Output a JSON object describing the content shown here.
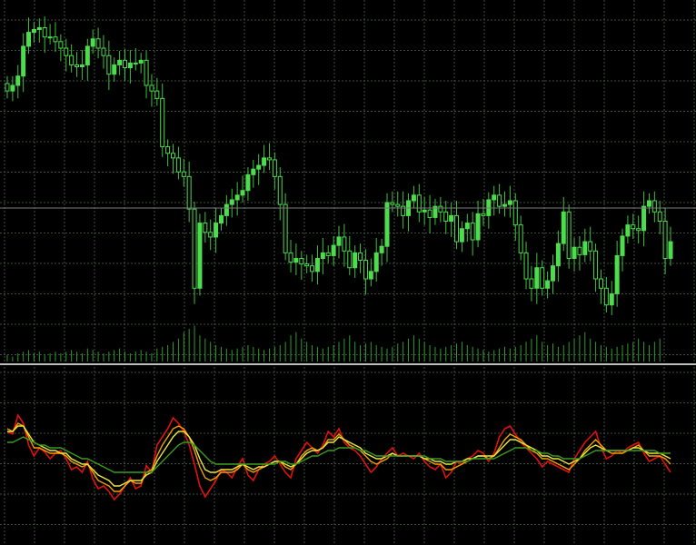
{
  "chart_data": [
    {
      "type": "candlestick",
      "panel": "price",
      "colors": {
        "candle": "#4ddc4d",
        "wick": "#3fbf3f",
        "grid": "#3d4f3d",
        "background": "#000000",
        "hline": "#7a7a7a"
      },
      "grid": true,
      "x": [
        0,
        1,
        2,
        3,
        4,
        5,
        6,
        7,
        8,
        9,
        10,
        11,
        12,
        13,
        14,
        15,
        16,
        17,
        18,
        19,
        20,
        21,
        22,
        23,
        24,
        25,
        26,
        27,
        28,
        29,
        30,
        31,
        32,
        33,
        34,
        35,
        36,
        37,
        38,
        39,
        40,
        41,
        42,
        43,
        44,
        45,
        46,
        47,
        48,
        49,
        50,
        51,
        52,
        53,
        54,
        55,
        56,
        57,
        58,
        59,
        60,
        61,
        62,
        63,
        64,
        65,
        66,
        67,
        68,
        69,
        70,
        71,
        72,
        73,
        74,
        75,
        76,
        77,
        78,
        79,
        80,
        81,
        82,
        83,
        84,
        85,
        86,
        87,
        88,
        89,
        90,
        91,
        92,
        93,
        94,
        95,
        96,
        97,
        98,
        99,
        100,
        101,
        102,
        103,
        104,
        105,
        106,
        107,
        108,
        109,
        110,
        111,
        112,
        113,
        114,
        115,
        116,
        117,
        118,
        119,
        120,
        121,
        122
      ],
      "close": [
        88,
        82,
        72,
        40,
        25,
        22,
        20,
        30,
        30,
        35,
        42,
        50,
        60,
        62,
        60,
        40,
        32,
        42,
        50,
        70,
        60,
        55,
        63,
        58,
        58,
        55,
        82,
        88,
        96,
        148,
        155,
        160,
        175,
        180,
        215,
        300,
        230,
        240,
        245,
        230,
        222,
        210,
        205,
        200,
        195,
        178,
        172,
        168,
        160,
        162,
        180,
        210,
        262,
        272,
        268,
        274,
        276,
        282,
        268,
        262,
        265,
        254,
        245,
        260,
        278,
        262,
        270,
        290,
        282,
        262,
        255,
        208,
        210,
        212,
        222,
        206,
        200,
        218,
        216,
        224,
        212,
        218,
        228,
        222,
        250,
        236,
        230,
        248,
        220,
        222,
        205,
        200,
        212,
        210,
        206,
        232,
        262,
        290,
        300,
        278,
        300,
        292,
        276,
        252,
        218,
        268,
        256,
        264,
        250,
        260,
        290,
        300,
        318,
        306,
        265,
        244,
        232,
        236,
        238,
        212,
        206,
        218,
        228,
        268,
        250
      ],
      "open": [
        80,
        88,
        82,
        72,
        40,
        25,
        22,
        20,
        30,
        30,
        35,
        42,
        50,
        60,
        62,
        60,
        40,
        32,
        42,
        50,
        70,
        60,
        55,
        63,
        58,
        58,
        55,
        82,
        88,
        96,
        148,
        155,
        160,
        175,
        180,
        215,
        300,
        230,
        240,
        245,
        230,
        222,
        210,
        205,
        200,
        195,
        178,
        172,
        168,
        160,
        162,
        180,
        210,
        262,
        272,
        268,
        274,
        276,
        282,
        268,
        262,
        265,
        254,
        245,
        260,
        278,
        262,
        270,
        290,
        282,
        262,
        255,
        208,
        210,
        212,
        222,
        206,
        200,
        218,
        216,
        224,
        212,
        218,
        228,
        222,
        250,
        236,
        230,
        248,
        220,
        222,
        205,
        200,
        212,
        210,
        206,
        232,
        262,
        290,
        300,
        278,
        300,
        292,
        276,
        252,
        218,
        268,
        256,
        264,
        250,
        260,
        290,
        300,
        318,
        306,
        265,
        244,
        232,
        236,
        238,
        212,
        206,
        218,
        228,
        268
      ],
      "volume": [
        4,
        3,
        5,
        6,
        7,
        5,
        6,
        4,
        5,
        6,
        5,
        6,
        7,
        6,
        5,
        8,
        7,
        6,
        5,
        6,
        7,
        8,
        6,
        5,
        6,
        7,
        6,
        5,
        8,
        9,
        10,
        12,
        14,
        18,
        20,
        22,
        16,
        14,
        12,
        10,
        9,
        8,
        7,
        8,
        9,
        10,
        9,
        8,
        7,
        8,
        9,
        10,
        12,
        16,
        18,
        14,
        12,
        10,
        9,
        8,
        9,
        10,
        12,
        14,
        16,
        12,
        10,
        11,
        12,
        10,
        9,
        8,
        9,
        11,
        12,
        14,
        16,
        14,
        12,
        10,
        9,
        8,
        9,
        10,
        11,
        12,
        10,
        9,
        8,
        7,
        6,
        7,
        8,
        9,
        8,
        9,
        10,
        12,
        14,
        16,
        12,
        10,
        11,
        9,
        10,
        12,
        14,
        16,
        18,
        14,
        12,
        10,
        9,
        8,
        9,
        10,
        11,
        12,
        14,
        12,
        10,
        12,
        14
      ]
    },
    {
      "type": "line",
      "panel": "oscillator",
      "grid": true,
      "series": [
        {
          "color": "#e01010",
          "values": [
            70,
            68,
            82,
            76,
            60,
            52,
            58,
            55,
            50,
            54,
            56,
            50,
            42,
            44,
            40,
            48,
            35,
            28,
            30,
            26,
            20,
            24,
            30,
            36,
            28,
            30,
            45,
            40,
            60,
            66,
            72,
            80,
            76,
            70,
            60,
            46,
            30,
            22,
            28,
            34,
            42,
            40,
            36,
            44,
            50,
            38,
            34,
            42,
            46,
            48,
            52,
            46,
            40,
            36,
            50,
            56,
            62,
            58,
            54,
            60,
            70,
            66,
            72,
            62,
            58,
            56,
            52,
            46,
            40,
            44,
            50,
            54,
            58,
            52,
            54,
            52,
            50,
            54,
            48,
            44,
            42,
            46,
            36,
            40,
            48,
            46,
            50,
            52,
            56,
            54,
            48,
            54,
            66,
            72,
            74,
            68,
            62,
            58,
            54,
            50,
            44,
            48,
            46,
            44,
            42,
            40,
            50,
            56,
            62,
            66,
            70,
            58,
            50,
            52,
            56,
            54,
            58,
            60,
            62,
            54,
            48,
            50,
            52,
            46,
            40
          ]
        },
        {
          "color": "#f0a000",
          "values": [
            72,
            70,
            76,
            74,
            66,
            58,
            58,
            56,
            54,
            54,
            54,
            52,
            48,
            46,
            44,
            46,
            40,
            34,
            32,
            30,
            26,
            26,
            30,
            34,
            32,
            32,
            40,
            42,
            52,
            60,
            66,
            72,
            74,
            72,
            66,
            56,
            44,
            36,
            34,
            36,
            40,
            40,
            40,
            42,
            46,
            42,
            40,
            42,
            44,
            46,
            48,
            48,
            44,
            42,
            46,
            52,
            56,
            58,
            56,
            58,
            64,
            64,
            68,
            64,
            60,
            58,
            56,
            52,
            48,
            46,
            48,
            50,
            54,
            52,
            52,
            52,
            52,
            52,
            50,
            48,
            46,
            46,
            42,
            42,
            44,
            46,
            48,
            50,
            52,
            52,
            50,
            52,
            58,
            64,
            68,
            66,
            64,
            60,
            56,
            54,
            50,
            50,
            48,
            46,
            44,
            42,
            46,
            50,
            56,
            60,
            64,
            60,
            56,
            54,
            54,
            54,
            56,
            58,
            60,
            56,
            52,
            52,
            52,
            50,
            46
          ]
        },
        {
          "color": "#e8e840",
          "values": [
            70,
            70,
            74,
            74,
            68,
            62,
            60,
            58,
            56,
            56,
            54,
            54,
            50,
            48,
            46,
            46,
            42,
            38,
            36,
            34,
            30,
            30,
            32,
            34,
            34,
            34,
            38,
            40,
            48,
            54,
            60,
            66,
            70,
            70,
            66,
            60,
            50,
            42,
            40,
            40,
            42,
            42,
            42,
            44,
            46,
            44,
            42,
            44,
            44,
            46,
            48,
            48,
            46,
            44,
            46,
            50,
            54,
            56,
            56,
            58,
            62,
            62,
            66,
            64,
            62,
            60,
            58,
            54,
            52,
            50,
            50,
            52,
            54,
            52,
            52,
            52,
            52,
            52,
            50,
            50,
            48,
            48,
            46,
            46,
            48,
            48,
            50,
            50,
            52,
            52,
            52,
            52,
            56,
            60,
            64,
            64,
            62,
            60,
            58,
            56,
            52,
            52,
            50,
            50,
            48,
            46,
            48,
            50,
            54,
            58,
            60,
            58,
            56,
            56,
            56,
            56,
            56,
            58,
            58,
            56,
            54,
            54,
            54,
            52,
            50
          ]
        },
        {
          "color": "#3a9a20",
          "values": [
            62,
            62,
            64,
            66,
            64,
            62,
            60,
            60,
            58,
            58,
            58,
            56,
            54,
            52,
            50,
            50,
            48,
            46,
            44,
            42,
            40,
            40,
            40,
            40,
            40,
            40,
            40,
            40,
            44,
            48,
            52,
            56,
            60,
            62,
            62,
            60,
            56,
            52,
            48,
            46,
            46,
            46,
            46,
            46,
            46,
            46,
            46,
            46,
            46,
            46,
            46,
            48,
            48,
            46,
            46,
            48,
            50,
            52,
            52,
            54,
            56,
            56,
            58,
            58,
            58,
            58,
            56,
            56,
            54,
            52,
            52,
            52,
            52,
            52,
            52,
            52,
            52,
            52,
            52,
            50,
            50,
            50,
            48,
            48,
            48,
            48,
            48,
            50,
            50,
            50,
            50,
            50,
            52,
            54,
            56,
            58,
            58,
            58,
            56,
            56,
            54,
            54,
            52,
            52,
            50,
            50,
            50,
            50,
            52,
            54,
            56,
            56,
            56,
            56,
            56,
            56,
            56,
            56,
            56,
            56,
            56,
            56,
            54,
            54,
            54
          ]
        }
      ]
    }
  ]
}
